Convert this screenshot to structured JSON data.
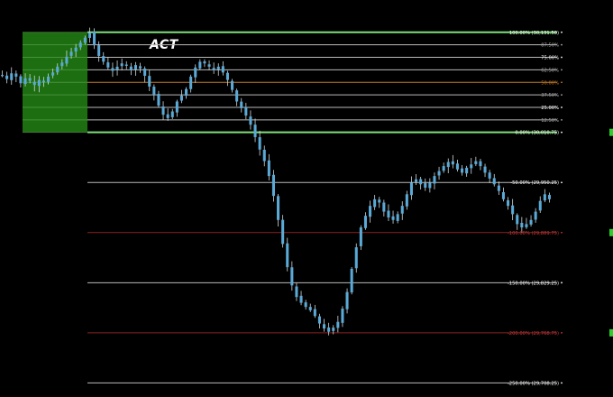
{
  "chart_data": {
    "type": "candlestick",
    "title": "ACT",
    "colors": {
      "background": "#000000",
      "candle": "#5aa9d6",
      "wick": "#cfd8dc",
      "zone": "#1f7a12",
      "level_light": "#b9b9b9",
      "level_strong_green": "#7fe07a",
      "level_red": "#8a2222",
      "level_orange": "#c47a2a",
      "label_white": "#ffffff",
      "label_gray": "#a6a6a6",
      "label_orange": "#c47a2a",
      "label_red": "#c23a3a",
      "marker_green": "#2bd12b"
    },
    "y_range": [
      29700,
      30140
    ],
    "price_path": [
      30080,
      30075,
      30082,
      30078,
      30070,
      30076,
      30073,
      30068,
      30074,
      30071,
      30078,
      30083,
      30090,
      30095,
      30102,
      30108,
      30113,
      30119,
      30125,
      30131,
      30116,
      30103,
      30096,
      30089,
      30085,
      30090,
      30094,
      30091,
      30086,
      30092,
      30088,
      30079,
      30066,
      30056,
      30043,
      30032,
      30028,
      30036,
      30048,
      30055,
      30063,
      30078,
      30089,
      30096,
      30094,
      30090,
      30086,
      30090,
      30083,
      30074,
      30062,
      30048,
      30040,
      30031,
      30020,
      30005,
      29990,
      29976,
      29958,
      29934,
      29905,
      29876,
      29848,
      29826,
      29812,
      29805,
      29800,
      29796,
      29789,
      29780,
      29774,
      29770,
      29775,
      29782,
      29798,
      29818,
      29846,
      29872,
      29896,
      29910,
      29922,
      29930,
      29926,
      29915,
      29908,
      29905,
      29912,
      29922,
      29936,
      29950,
      29954,
      29948,
      29944,
      29950,
      29958,
      29964,
      29970,
      29975,
      29972,
      29966,
      29962,
      29968,
      29972,
      29976,
      29970,
      29962,
      29955,
      29948,
      29940,
      29930,
      29922,
      29912,
      29900,
      29896,
      29900,
      29905,
      29915,
      29928,
      29936,
      29930
    ],
    "levels": [
      {
        "label": "100.00% (30,131.50)",
        "value": 30131.5,
        "line": "level_strong_green",
        "text": "label_white",
        "bright": true
      },
      {
        "label": "87.50%",
        "value": 30116.4,
        "line": "level_light",
        "text": "label_gray"
      },
      {
        "label": "75.00%",
        "value": 30101.3,
        "line": "level_light",
        "text": "label_white"
      },
      {
        "label": "62.50%",
        "value": 30086.2,
        "line": "level_light",
        "text": "label_gray"
      },
      {
        "label": "50.00%",
        "value": 30071.1,
        "line": "level_orange",
        "text": "label_orange"
      },
      {
        "label": "37.50%",
        "value": 30056.0,
        "line": "level_light",
        "text": "label_gray"
      },
      {
        "label": "25.00%",
        "value": 30040.9,
        "line": "level_light",
        "text": "label_white"
      },
      {
        "label": "12.50%",
        "value": 30025.8,
        "line": "level_light",
        "text": "label_gray"
      },
      {
        "label": "0.00% (30,010.75)",
        "value": 30010.75,
        "line": "level_strong_green",
        "text": "label_white",
        "bright": true
      },
      {
        "label": "-50.00% (29,950.25)",
        "value": 29950.25,
        "line": "level_light",
        "text": "label_white"
      },
      {
        "label": "-100.00% (29,889.75)",
        "value": 29889.75,
        "line": "level_red",
        "text": "label_red"
      },
      {
        "label": "-150.00% (29,829.25)",
        "value": 29829.25,
        "line": "level_light",
        "text": "label_white"
      },
      {
        "label": "-200.00% (29,768.75)",
        "value": 29768.75,
        "line": "level_red",
        "text": "label_red"
      },
      {
        "label": "-250.00% (29,708.25)",
        "value": 29708.25,
        "line": "level_light",
        "text": "label_white"
      }
    ],
    "zone": {
      "from": 30010.75,
      "to": 30131.5
    },
    "markers": [
      30010.75,
      29889.75,
      29768.75
    ]
  }
}
